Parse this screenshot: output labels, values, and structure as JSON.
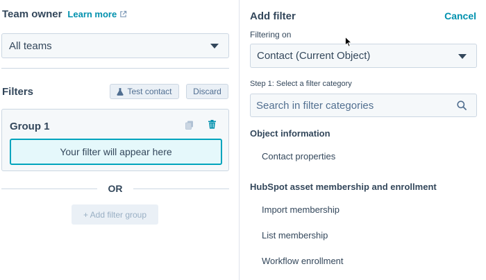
{
  "team_owner": {
    "title": "Team owner",
    "learn_more": "Learn more",
    "selected_team": "All teams"
  },
  "filters": {
    "title": "Filters",
    "test_contact_label": "Test contact",
    "discard_label": "Discard"
  },
  "group": {
    "title": "Group 1",
    "placeholder": "Your filter will appear here"
  },
  "or_label": "OR",
  "add_filter_group_label": "+ Add filter group",
  "add_filter_panel": {
    "title": "Add filter",
    "cancel_label": "Cancel",
    "filtering_on_label": "Filtering on",
    "filtering_on_value": "Contact (Current Object)",
    "step_label": "Step 1: Select a filter category",
    "search_placeholder": "Search in filter categories",
    "sections": [
      {
        "heading": "Object information",
        "items": [
          "Contact properties"
        ]
      },
      {
        "heading": "HubSpot asset membership and enrollment",
        "items": [
          "Import membership",
          "List membership",
          "Workflow enrollment"
        ]
      }
    ]
  },
  "colors": {
    "link": "#0091ae",
    "text": "#33475b",
    "border": "#cbd6e2",
    "placeholder_border": "#00a4bd",
    "placeholder_bg": "#e5f8fb"
  },
  "icons": {
    "external_link": "external-link-icon",
    "flask": "flask-icon",
    "copy": "copy-icon",
    "trash": "trash-icon",
    "search": "search-icon",
    "caret": "chevron-down-icon",
    "cursor": "mouse-cursor-icon"
  }
}
